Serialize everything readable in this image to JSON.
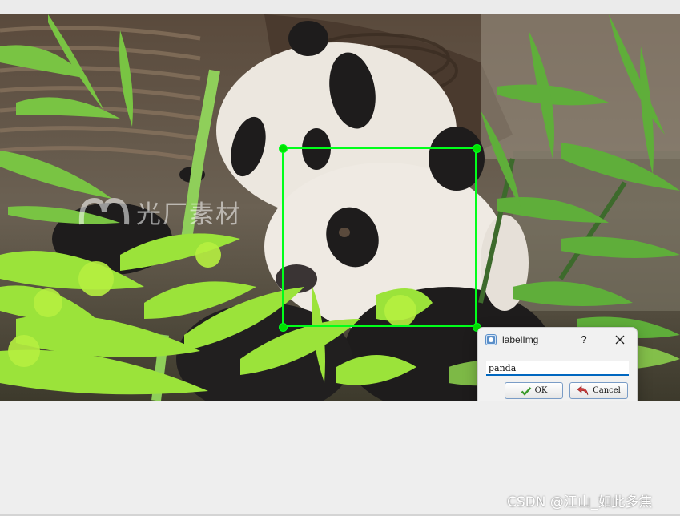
{
  "watermark": {
    "text": "光厂素材",
    "icon": "camera-aperture-logo"
  },
  "annotation": {
    "box_color": "#00ff1a",
    "handle_color": "#00e000"
  },
  "dialog": {
    "title": "labelImg",
    "app_icon": "labelimg-app-icon",
    "help_label": "?",
    "close_icon": "close-icon",
    "input_value": "panda",
    "input_focus_color": "#0067c0",
    "ok_label": "OK",
    "ok_icon": "checkmark-icon",
    "cancel_label": "Cancel",
    "cancel_icon": "undo-arrow-icon"
  },
  "footer": {
    "credit": "CSDN @江山_如此多焦"
  },
  "colors": {
    "canvas_background": "#eeeeee",
    "bamboo_green": "#7ed321",
    "panda_white": "#efeae3",
    "panda_black": "#1e1c1c"
  }
}
